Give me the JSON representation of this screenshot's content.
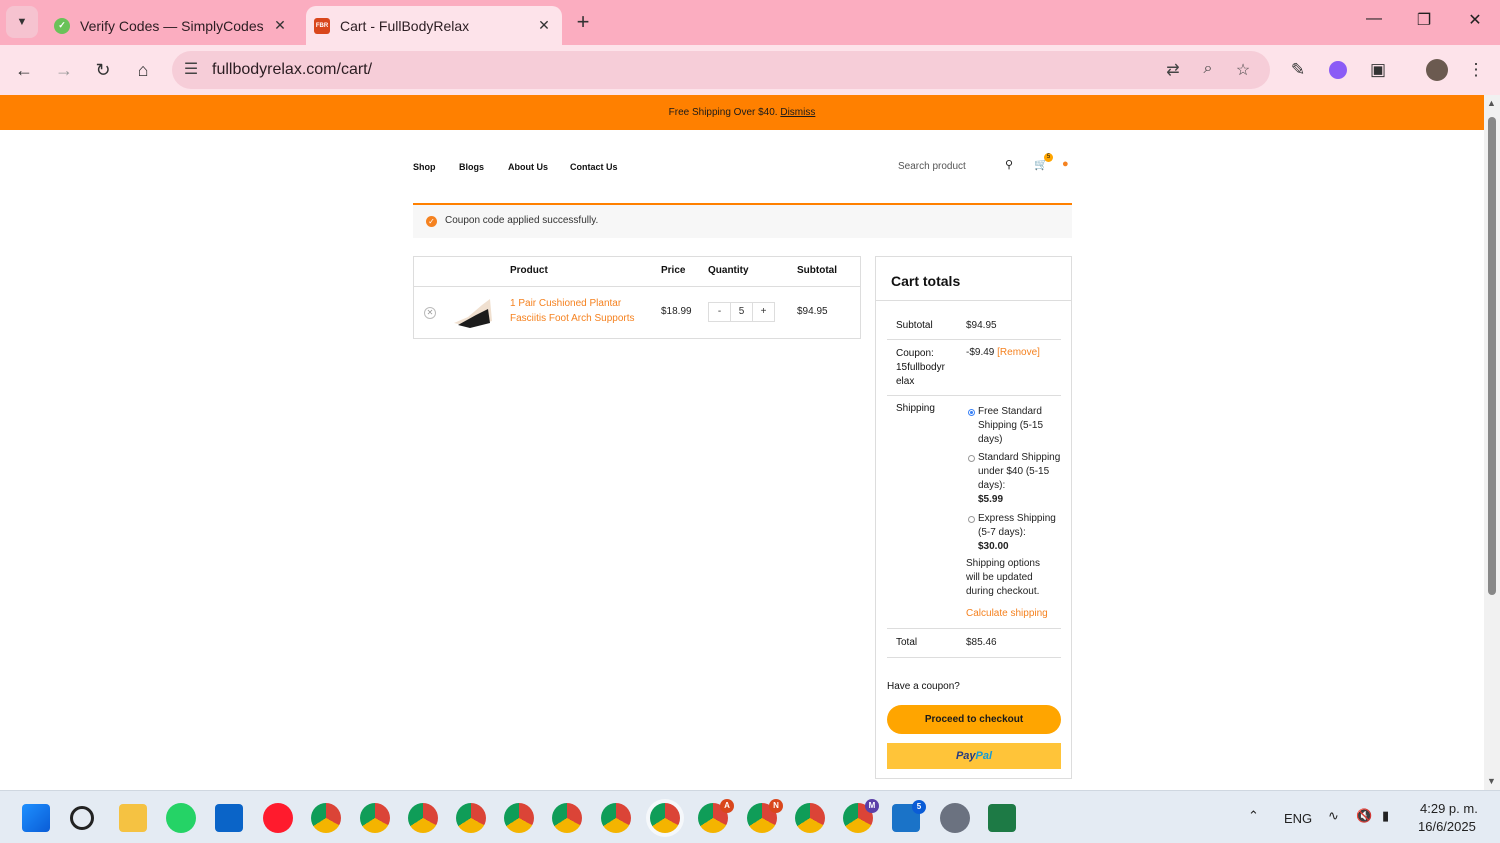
{
  "browser": {
    "tabs": [
      {
        "title": "Verify Codes — SimplyCodes",
        "active": false
      },
      {
        "title": "Cart - FullBodyRelax",
        "active": true
      }
    ],
    "active_favicon_text": "FBR",
    "address": "fullbodyrelax.com/cart/"
  },
  "site": {
    "promo_text": "Free Shipping Over $40.",
    "promo_link": "Dismiss",
    "nav": [
      "Shop",
      "Blogs",
      "About Us",
      "Contact Us"
    ],
    "search_placeholder": "Search product",
    "cart_count": "5"
  },
  "notice": {
    "message": "Coupon code applied successfully."
  },
  "cart": {
    "headers": {
      "product": "Product",
      "price": "Price",
      "quantity": "Quantity",
      "subtotal": "Subtotal"
    },
    "items": [
      {
        "name": "1 Pair Cushioned Plantar Fasciitis Foot Arch Supports",
        "price": "$18.99",
        "qty": "5",
        "subtotal": "$94.95"
      }
    ],
    "qty_minus": "-",
    "qty_plus": "+"
  },
  "totals": {
    "title": "Cart totals",
    "subtotal_label": "Subtotal",
    "subtotal_value": "$94.95",
    "coupon_label": "Coupon: 15fullbodyr elax",
    "coupon_value": "-$9.49",
    "coupon_remove": "[Remove]",
    "shipping_label": "Shipping",
    "shipping_options": [
      {
        "label": "Free Standard Shipping (5-15 days)",
        "price": "",
        "selected": true
      },
      {
        "label": "Standard Shipping under $40 (5-15 days):",
        "price": "$5.99",
        "selected": false
      },
      {
        "label": "Express Shipping (5-7 days):",
        "price": "$30.00",
        "selected": false
      }
    ],
    "shipping_note": "Shipping options will be updated during checkout.",
    "calc_shipping": "Calculate shipping",
    "total_label": "Total",
    "total_value": "$85.46",
    "coupon_prompt": "Have a coupon?",
    "checkout_btn": "Proceed to checkout",
    "paypal_pay": "Pay",
    "paypal_pal": "Pal"
  },
  "taskbar": {
    "lang": "ENG",
    "time": "4:29 p. m.",
    "date": "16/6/2025",
    "badges": {
      "a": "A",
      "n": "N",
      "m": "M",
      "five": "5"
    }
  },
  "colors": {
    "accent": "#ff8000",
    "link": "#f58220",
    "tabstrip": "#fbadc0"
  }
}
